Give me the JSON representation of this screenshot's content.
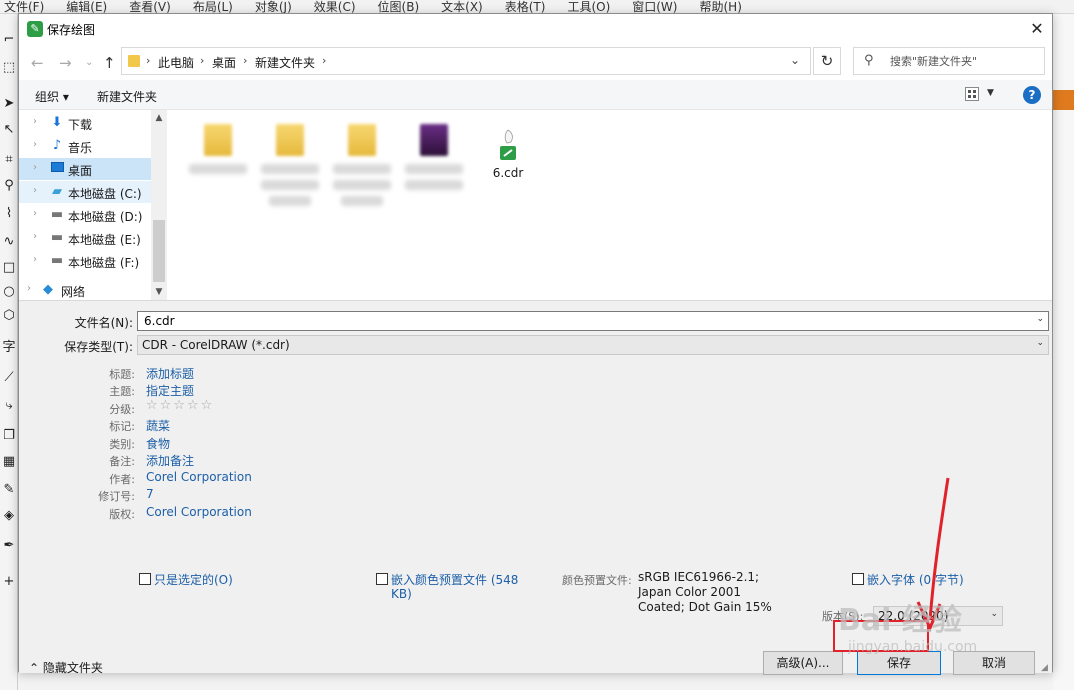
{
  "app": {
    "menu": [
      "文件(F)",
      "编辑(E)",
      "查看(V)",
      "布局(L)",
      "对象(J)",
      "效果(C)",
      "位图(B)",
      "文本(X)",
      "表格(T)",
      "工具(O)",
      "窗口(W)",
      "帮助(H)"
    ],
    "accent_color": "#e07a1f"
  },
  "dialog": {
    "title": "保存绘图",
    "title_icon": "coreldraw-app-icon",
    "close_glyph": "✕"
  },
  "address": {
    "crumbs": [
      "此电脑",
      "桌面",
      "新建文件夹"
    ],
    "search_placeholder": "搜索\"新建文件夹\""
  },
  "commands": {
    "organize": "组织 ▾",
    "new_folder": "新建文件夹"
  },
  "nav": {
    "items": [
      {
        "label": "下载",
        "icon": "download-arrow-icon"
      },
      {
        "label": "音乐",
        "icon": "music-note-icon"
      },
      {
        "label": "桌面",
        "icon": "desktop-icon"
      },
      {
        "label": "本地磁盘 (C:)",
        "icon": "system-drive-icon"
      },
      {
        "label": "本地磁盘 (D:)",
        "icon": "drive-icon"
      },
      {
        "label": "本地磁盘 (E:)",
        "icon": "drive-icon"
      },
      {
        "label": "本地磁盘 (F:)",
        "icon": "drive-icon"
      },
      {
        "label": "网络",
        "icon": "network-icon"
      }
    ]
  },
  "files": {
    "cdr_file": "6.cdr"
  },
  "form": {
    "filename_label": "文件名(N):",
    "filename_value": "6.cdr",
    "filetype_label": "保存类型(T):",
    "filetype_value": "CDR - CorelDRAW (*.cdr)"
  },
  "metadata": {
    "title_label": "标题:",
    "title_value": "添加标题",
    "subject_label": "主题:",
    "subject_value": "指定主题",
    "rating_label": "分级:",
    "rating_stars": "☆☆☆☆☆",
    "tags_label": "标记:",
    "tags_value": "蔬菜",
    "category_label": "类别:",
    "category_value": "食物",
    "notes_label": "备注:",
    "notes_value": "添加备注",
    "author_label": "作者:",
    "author_value": "Corel Corporation",
    "revision_label": "修订号:",
    "revision_value": "7",
    "copyright_label": "版权:",
    "copyright_value": "Corel Corporation"
  },
  "options": {
    "selected_only": "只是选定的(O)",
    "embed_profile_1": "嵌入颜色预置文件 (548",
    "embed_profile_2": "KB)",
    "profile_label": "颜色预置文件:",
    "profile_line1": "sRGB IEC61966-2.1;",
    "profile_line2": "Japan Color 2001",
    "profile_line3": "Coated; Dot Gain 15%",
    "embed_fonts": "嵌入字体 (0 字节)",
    "version_label": "版本(S):",
    "version_value": "22.0 (2020)"
  },
  "footer": {
    "hide_folders": "隐藏文件夹",
    "advanced": "高级(A)...",
    "save": "保存",
    "cancel": "取消"
  },
  "watermark": {
    "main": "Bai 经验",
    "sub": "jingyan.baidu.com"
  },
  "colors": {
    "highlight": "#e0232b",
    "link": "#1c5fa8",
    "selected_nav": "#cce4f7"
  }
}
